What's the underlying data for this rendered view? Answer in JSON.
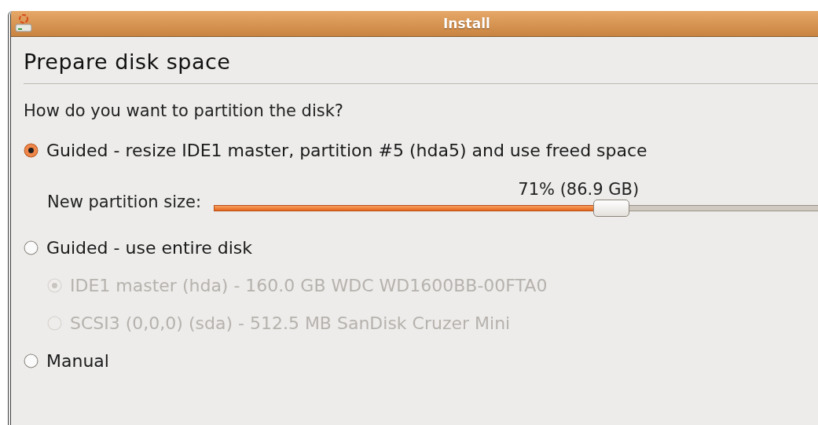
{
  "window": {
    "title": "Install"
  },
  "heading": "Prepare disk space",
  "question": "How do you want to partition the disk?",
  "options": [
    {
      "label": "Guided - resize IDE1 master, partition #5 (hda5) and use freed space",
      "selected": true,
      "resize": {
        "label": "New partition size:",
        "reading": "71% (86.9 GB)",
        "level": 0.61
      }
    },
    {
      "label": "Guided - use entire disk",
      "selected": false,
      "disks": [
        {
          "label": "IDE1 master (hda) - 160.0 GB WDC WD1600BB-00FTA0",
          "selected": true,
          "disabled": true
        },
        {
          "label": "SCSI3 (0,0,0) (sda) - 512.5 MB SanDisk Cruzer Mini",
          "selected": false,
          "disabled": true
        }
      ]
    },
    {
      "label": "Manual",
      "selected": false
    }
  ]
}
